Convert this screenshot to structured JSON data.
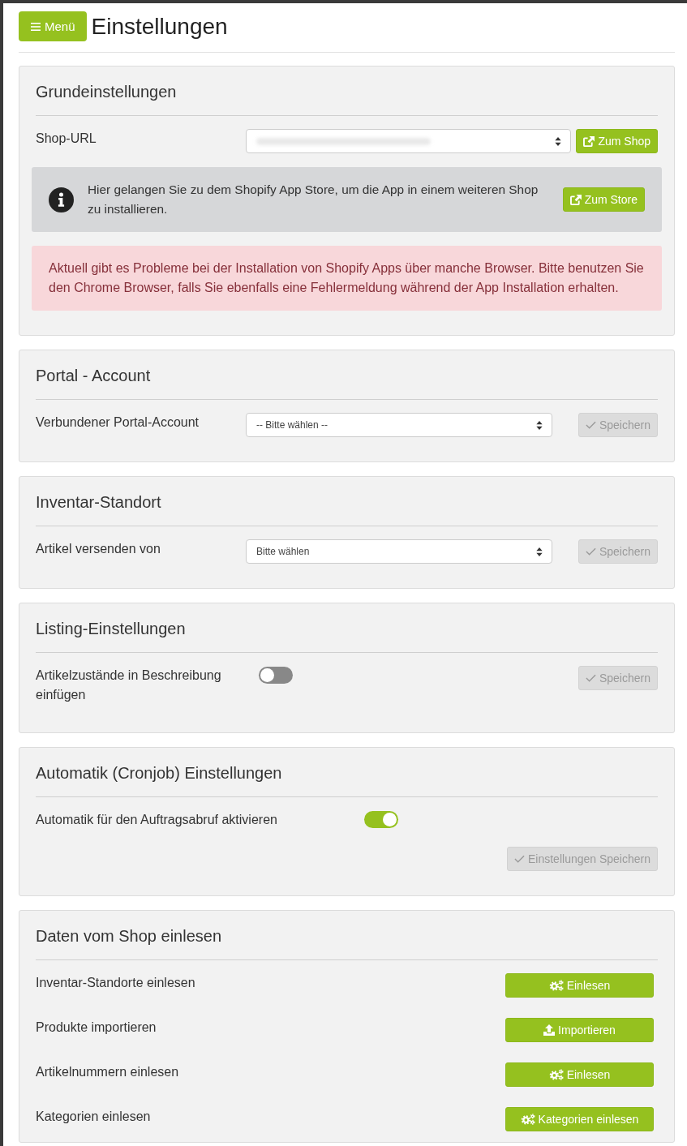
{
  "header": {
    "menu_button": {
      "label": "Menü"
    },
    "title": "Einstellungen"
  },
  "sections": [
    {
      "title": "Grundeinstellungen",
      "rows": [
        {
          "kind": "select",
          "label": "Shop-URL",
          "value_blurred": true,
          "button": {
            "kind": "external",
            "label": "Zum Shop",
            "disabled": false
          }
        }
      ],
      "alerts": [
        {
          "kind": "info",
          "text": "Hier gelangen Sie zu dem Shopify App Store, um die App in einem weiteren Shop zu installieren.",
          "button": {
            "kind": "external",
            "label": "Zum Store",
            "disabled": false
          }
        },
        {
          "kind": "danger",
          "text": "Aktuell gibt es Probleme bei der Installation von Shopify Apps über manche Browser. Bitte benutzen Sie den Chrome Browser, falls Sie ebenfalls eine Fehlermeldung während der App Installation erhalten."
        }
      ]
    },
    {
      "title": "Portal - Account",
      "rows": [
        {
          "kind": "select",
          "label": "Verbundener Portal-Account",
          "value": "-- Bitte wählen --",
          "button": {
            "kind": "save",
            "label": "Speichern",
            "disabled": true
          }
        }
      ]
    },
    {
      "title": "Inventar-Standort",
      "rows": [
        {
          "kind": "select",
          "label": "Artikel versenden von",
          "value": "Bitte wählen",
          "button": {
            "kind": "save",
            "label": "Speichern",
            "disabled": true
          }
        }
      ]
    },
    {
      "title": "Listing-Einstellungen",
      "rows": [
        {
          "kind": "toggle",
          "label": "Artikelzustände in Beschreibung einfügen",
          "on": false,
          "button": {
            "kind": "save",
            "label": "Speichern",
            "disabled": true
          }
        }
      ]
    },
    {
      "title": "Automatik (Cronjob) Einstellungen",
      "rows": [
        {
          "kind": "toggle",
          "label": "Automatik für den Auftragsabruf aktivieren",
          "on": true
        }
      ],
      "footer_button": {
        "kind": "save",
        "label": "Einstellungen Speichern",
        "disabled": true
      }
    },
    {
      "title": "Daten vom Shop einlesen",
      "rows": [
        {
          "kind": "action",
          "label": "Inventar-Standorte einlesen",
          "button": {
            "kind": "process",
            "label": "Einlesen",
            "disabled": false
          }
        },
        {
          "kind": "action",
          "label": "Produkte importieren",
          "button": {
            "kind": "upload",
            "label": "Importieren",
            "disabled": false
          }
        },
        {
          "kind": "action",
          "label": "Artikelnummern einlesen",
          "button": {
            "kind": "process",
            "label": "Einlesen",
            "disabled": false
          }
        },
        {
          "kind": "action",
          "label": "Kategorien einlesen",
          "button": {
            "kind": "process",
            "label": "Kategorien einlesen",
            "disabled": false
          }
        }
      ]
    }
  ]
}
